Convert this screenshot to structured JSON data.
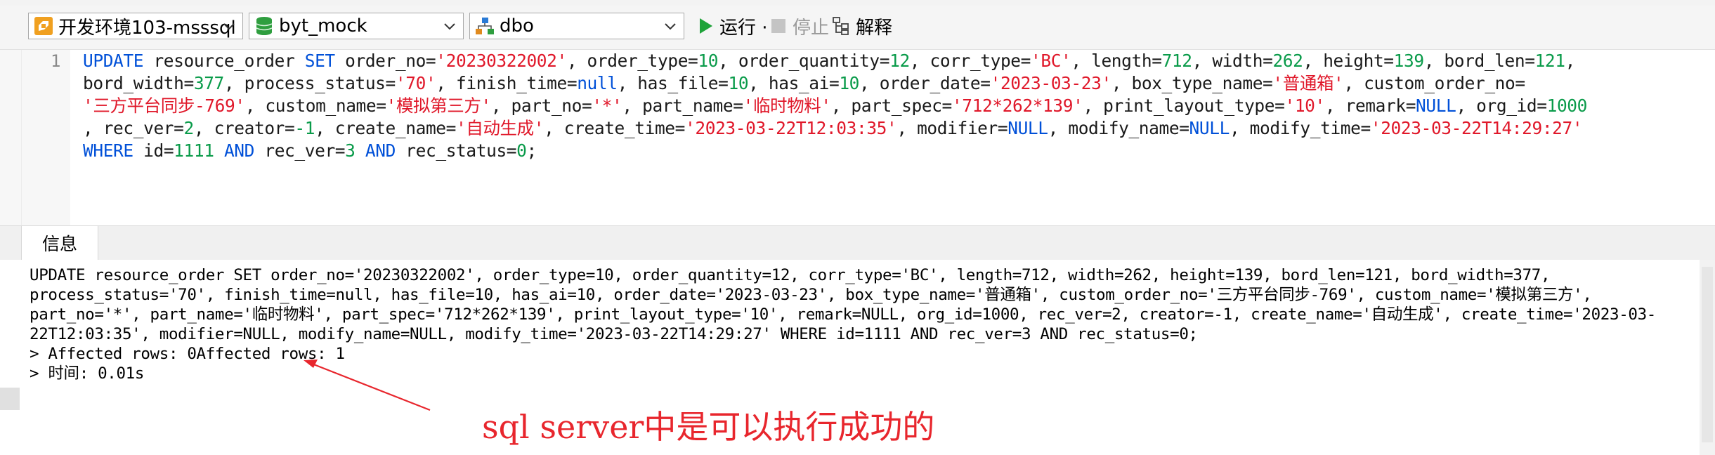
{
  "toolbar": {
    "connection": {
      "value": "开发环境103-msssql",
      "icon": "connection-icon"
    },
    "database": {
      "value": "byt_mock",
      "icon": "database-icon"
    },
    "schema": {
      "value": "dbo",
      "icon": "schema-icon"
    },
    "run_label": "运行 ·",
    "stop_label": "停止",
    "explain_label": "解释"
  },
  "editor": {
    "line_number": "1",
    "lines": [
      [
        [
          "k",
          "UPDATE"
        ],
        [
          "t",
          " resource_order "
        ],
        [
          "k",
          "SET"
        ],
        [
          "t",
          " order_no="
        ],
        [
          "s",
          "'20230322002'"
        ],
        [
          "t",
          ", order_type="
        ],
        [
          "n",
          "10"
        ],
        [
          "t",
          ", order_quantity="
        ],
        [
          "n",
          "12"
        ],
        [
          "t",
          ", corr_type="
        ],
        [
          "s",
          "'BC'"
        ],
        [
          "t",
          ", length="
        ],
        [
          "n",
          "712"
        ],
        [
          "t",
          ", width="
        ],
        [
          "n",
          "262"
        ],
        [
          "t",
          ", height="
        ],
        [
          "n",
          "139"
        ],
        [
          "t",
          ", bord_len="
        ],
        [
          "n",
          "121"
        ],
        [
          "t",
          ","
        ]
      ],
      [
        [
          "t",
          "bord_width="
        ],
        [
          "n",
          "377"
        ],
        [
          "t",
          ", process_status="
        ],
        [
          "s",
          "'70'"
        ],
        [
          "t",
          ", finish_time="
        ],
        [
          "k",
          "null"
        ],
        [
          "t",
          ", has_file="
        ],
        [
          "n",
          "10"
        ],
        [
          "t",
          ", has_ai="
        ],
        [
          "n",
          "10"
        ],
        [
          "t",
          ", order_date="
        ],
        [
          "s",
          "'2023-03-23'"
        ],
        [
          "t",
          ", box_type_name="
        ],
        [
          "s",
          "'普通箱'"
        ],
        [
          "t",
          ", custom_order_no="
        ]
      ],
      [
        [
          "s",
          "'三方平台同步-769'"
        ],
        [
          "t",
          ", custom_name="
        ],
        [
          "s",
          "'模拟第三方'"
        ],
        [
          "t",
          ", part_no="
        ],
        [
          "s",
          "'*'"
        ],
        [
          "t",
          ", part_name="
        ],
        [
          "s",
          "'临时物料'"
        ],
        [
          "t",
          ", part_spec="
        ],
        [
          "s",
          "'712*262*139'"
        ],
        [
          "t",
          ", print_layout_type="
        ],
        [
          "s",
          "'10'"
        ],
        [
          "t",
          ", remark="
        ],
        [
          "k",
          "NULL"
        ],
        [
          "t",
          ", org_id="
        ],
        [
          "n",
          "1000"
        ]
      ],
      [
        [
          "t",
          ", rec_ver="
        ],
        [
          "n",
          "2"
        ],
        [
          "t",
          ", creator="
        ],
        [
          "n",
          "-1"
        ],
        [
          "t",
          ", create_name="
        ],
        [
          "s",
          "'自动生成'"
        ],
        [
          "t",
          ", create_time="
        ],
        [
          "s",
          "'2023-03-22T12:03:35'"
        ],
        [
          "t",
          ", modifier="
        ],
        [
          "k",
          "NULL"
        ],
        [
          "t",
          ", modify_name="
        ],
        [
          "k",
          "NULL"
        ],
        [
          "t",
          ", modify_time="
        ],
        [
          "s",
          "'2023-03-22T14:29:27'"
        ]
      ],
      [
        [
          "k",
          "WHERE"
        ],
        [
          "t",
          " id="
        ],
        [
          "n",
          "1111"
        ],
        [
          "t",
          " "
        ],
        [
          "k",
          "AND"
        ],
        [
          "t",
          " rec_ver="
        ],
        [
          "n",
          "3"
        ],
        [
          "t",
          " "
        ],
        [
          "k",
          "AND"
        ],
        [
          "t",
          " rec_status="
        ],
        [
          "n",
          "0"
        ],
        [
          "t",
          ";"
        ]
      ]
    ],
    "colors": {
      "keyword": "#0050d8",
      "string": "#e0182a",
      "number": "#0a9b4a"
    }
  },
  "panel": {
    "tab_label": "信息",
    "output_lines": [
      "UPDATE resource_order SET order_no='20230322002', order_type=10, order_quantity=12, corr_type='BC', length=712, width=262, height=139, bord_len=121, bord_width=377,",
      "process_status='70', finish_time=null, has_file=10, has_ai=10, order_date='2023-03-23', box_type_name='普通箱', custom_order_no='三方平台同步-769', custom_name='模拟第三方',",
      "part_no='*', part_name='临时物料', part_spec='712*262*139', print_layout_type='10', remark=NULL, org_id=1000, rec_ver=2, creator=-1, create_name='自动生成', create_time='2023-03-",
      "22T12:03:35', modifier=NULL, modify_name=NULL, modify_time='2023-03-22T14:29:27' WHERE id=1111 AND rec_ver=3 AND rec_status=0;",
      "> Affected rows: 0Affected rows: 1",
      "> 时间: 0.01s"
    ]
  },
  "annotation": {
    "text": "sql server中是可以执行成功的",
    "color": "#e8262d"
  }
}
